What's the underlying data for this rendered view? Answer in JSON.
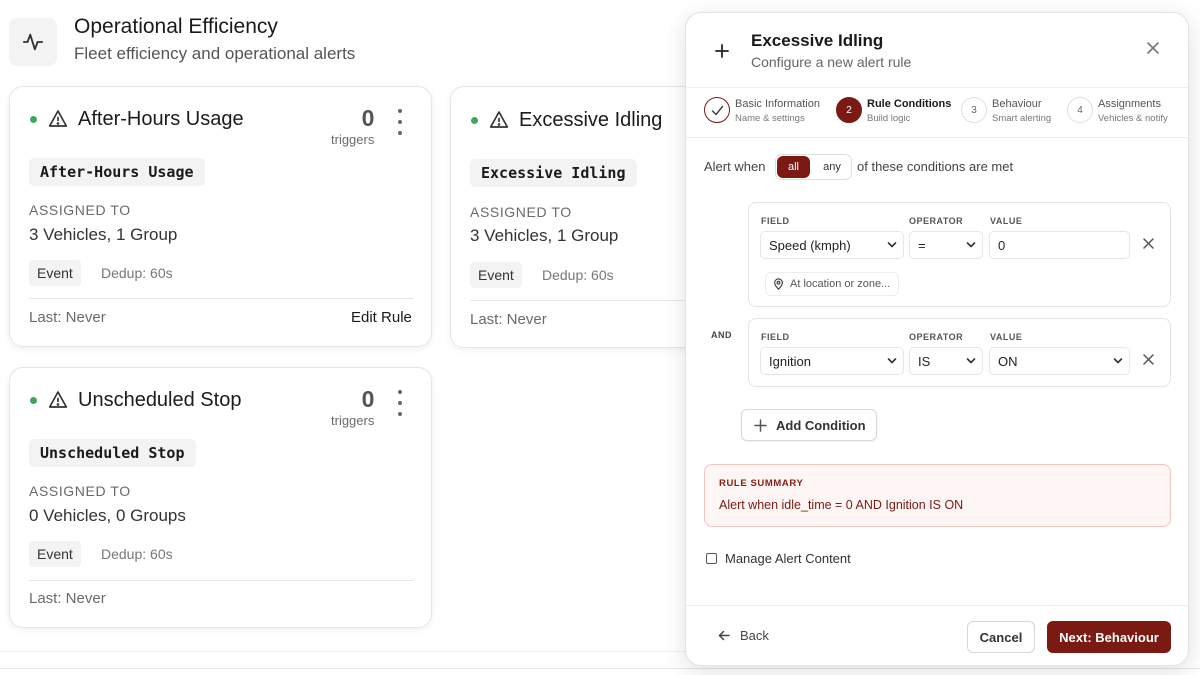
{
  "page": {
    "title": "Operational Efficiency",
    "subtitle": "Fleet efficiency and operational alerts",
    "header_icon": "activity-icon"
  },
  "cards": [
    {
      "title": "After-Hours Usage",
      "triggers_count": "0",
      "triggers_label": "triggers",
      "code": "After-Hours Usage",
      "assigned_label": "ASSIGNED TO",
      "assigned_value": "3 Vehicles, 1 Group",
      "event_label": "Event",
      "dedup": "Dedup: 60s",
      "last": "Last: Never",
      "edit_label": "Edit Rule",
      "status_color": "#3fa65c"
    },
    {
      "title": "Excessive Idling",
      "code": "Excessive Idling",
      "assigned_label": "ASSIGNED TO",
      "assigned_value": "3 Vehicles, 1 Group",
      "event_label": "Event",
      "dedup": "Dedup: 60s",
      "last": "Last: Never",
      "status_color": "#3fa65c"
    },
    {
      "title": "Unscheduled Stop",
      "triggers_count": "0",
      "triggers_label": "triggers",
      "code": "Unscheduled Stop",
      "assigned_label": "ASSIGNED TO",
      "assigned_value": "0 Vehicles, 0 Groups",
      "event_label": "Event",
      "dedup": "Dedup: 60s",
      "last": "Last: Never",
      "status_color": "#3fa65c"
    }
  ],
  "modal": {
    "title": "Excessive Idling",
    "subtitle": "Configure a new alert rule",
    "steps": [
      {
        "number": "",
        "title": "Basic Information",
        "subtitle": "Name & settings",
        "state": "done"
      },
      {
        "number": "2",
        "title": "Rule Conditions",
        "subtitle": "Build logic",
        "state": "active"
      },
      {
        "number": "3",
        "title": "Behaviour",
        "subtitle": "Smart alerting",
        "state": "pending"
      },
      {
        "number": "4",
        "title": "Assignments",
        "subtitle": "Vehicles & notify",
        "state": "pending"
      }
    ],
    "alert_when_label": "Alert when",
    "toggle": {
      "all": "all",
      "any": "any",
      "selected": "all"
    },
    "conditions_suffix": "of these conditions are met",
    "column_labels": {
      "field": "FIELD",
      "operator": "OPERATOR",
      "value": "VALUE"
    },
    "conditions": [
      {
        "field": "Speed (kmph)",
        "operator": "=",
        "value": "0",
        "location_label": "At location or zone..."
      },
      {
        "connector": "AND",
        "field": "Ignition",
        "operator": "IS",
        "value": "ON"
      }
    ],
    "add_condition_label": "Add Condition",
    "summary": {
      "label": "RULE SUMMARY",
      "text": "Alert when idle_time = 0 AND Ignition IS ON"
    },
    "manage_alert_content_label": "Manage Alert Content",
    "footer": {
      "back_label": "Back",
      "cancel_label": "Cancel",
      "next_label": "Next: Behaviour"
    }
  },
  "colors": {
    "accent": "#7a1a12",
    "status_active": "#3fa65c",
    "summary_bg": "#fdf6f5",
    "summary_border": "#f0c5c2"
  }
}
